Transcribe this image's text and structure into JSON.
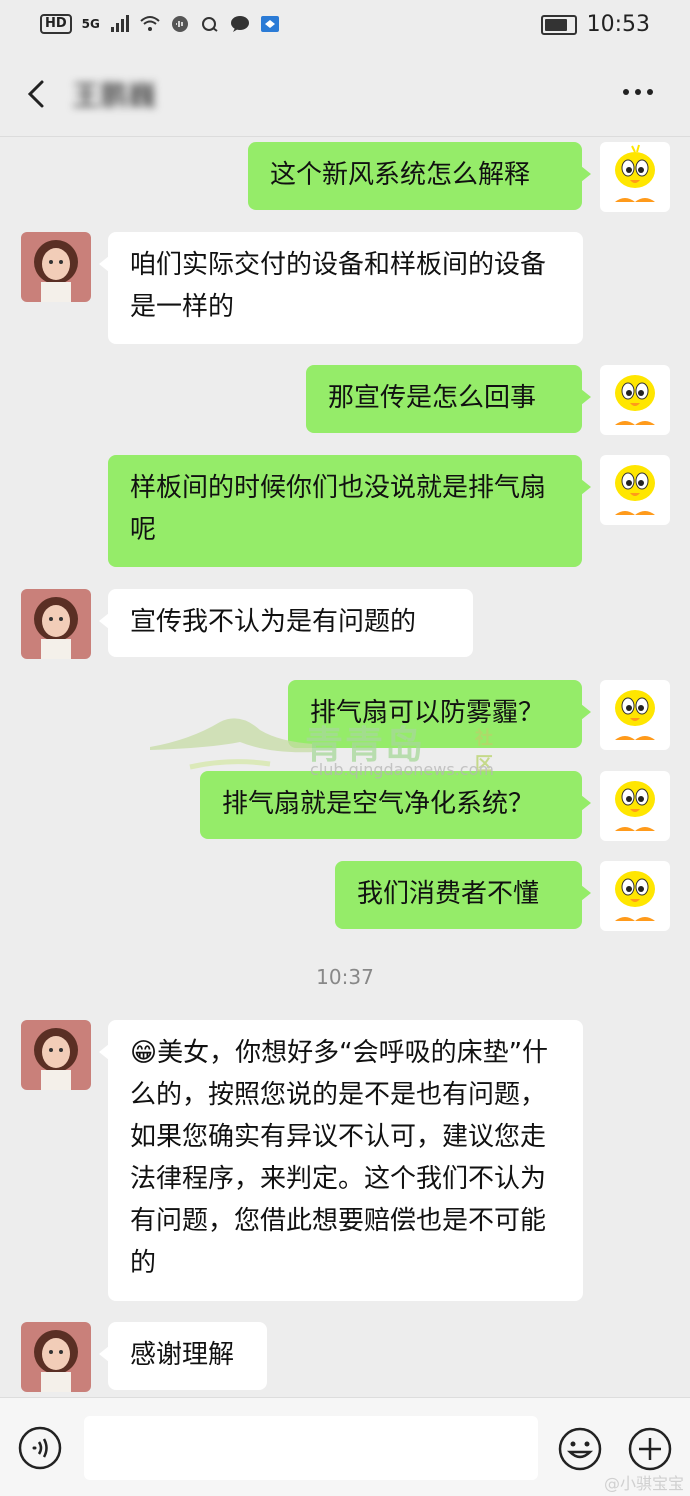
{
  "status_bar": {
    "hd": "HD",
    "network": "5G",
    "time": "10:53",
    "battery_level": 0.7
  },
  "nav": {
    "contact_name": "王鹏巍",
    "more_label": "···"
  },
  "messages": [
    {
      "side": "me",
      "text": "这个新风系统怎么解释"
    },
    {
      "side": "other",
      "text": "咱们实际交付的设备和样板间的设备是一样的"
    },
    {
      "side": "me",
      "text": "那宣传是怎么回事"
    },
    {
      "side": "me",
      "text": "样板间的时候你们也没说就是排气扇呢"
    },
    {
      "side": "other",
      "text": "宣传我不认为是有问题的"
    },
    {
      "side": "me",
      "text": "排气扇可以防雾霾？"
    },
    {
      "side": "me",
      "text": "排气扇就是空气净化系统？"
    },
    {
      "side": "me",
      "text": "我们消费者不懂"
    },
    {
      "side": "other",
      "emoji": "😁",
      "text": "美女，你想好多“会呼吸的床垫”什么的，按照您说的是不是也有问题，如果您确实有异议不认可，建议您走法律程序，来判定。这个我们不认为有问题，您借此想要赔偿也是不可能的"
    },
    {
      "side": "other",
      "text": "感谢理解"
    }
  ],
  "timestamp": "10:37",
  "watermark": {
    "title": "青青岛",
    "badge": "社区",
    "url": "club.qingdaonews.com"
  },
  "footer_tag": "@小骐宝宝",
  "colors": {
    "my_bubble": "#95ec69",
    "other_bubble": "#ffffff",
    "background": "#ededed"
  }
}
